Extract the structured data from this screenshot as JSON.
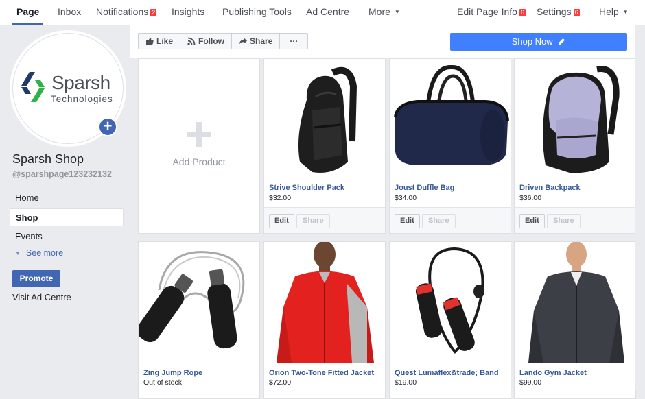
{
  "topnav": {
    "items": [
      {
        "label": "Page",
        "active": true
      },
      {
        "label": "Inbox"
      },
      {
        "label": "Notifications",
        "badge": "2"
      },
      {
        "label": "Insights"
      },
      {
        "label": "Publishing Tools"
      },
      {
        "label": "Ad Centre"
      },
      {
        "label": "More"
      }
    ],
    "right": [
      {
        "label": "Edit Page Info",
        "badge": "6"
      },
      {
        "label": "Settings",
        "badge": "6"
      },
      {
        "label": "Help"
      }
    ]
  },
  "profile": {
    "logo_text": "Sparsh",
    "logo_subtext": "Technologies",
    "page_name": "Sparsh Shop",
    "handle": "@sparshpage123232132"
  },
  "sidebar": {
    "items": [
      {
        "label": "Home"
      },
      {
        "label": "Shop",
        "active": true
      },
      {
        "label": "Events"
      }
    ],
    "see_more": "See more",
    "promote": "Promote",
    "visit_ad_centre": "Visit Ad Centre"
  },
  "actions": {
    "like": "Like",
    "follow": "Follow",
    "share": "Share",
    "more": "···",
    "shop_now": "Shop Now"
  },
  "shop": {
    "add_product": "Add Product",
    "edit_label": "Edit",
    "share_label": "Share",
    "products": [
      {
        "name": "Strive Shoulder Pack",
        "price": "$32.00",
        "image": "sling-backpack"
      },
      {
        "name": "Joust Duffle Bag",
        "price": "$34.00",
        "image": "duffle-bag"
      },
      {
        "name": "Driven Backpack",
        "price": "$36.00",
        "image": "backpack"
      },
      {
        "name": "Zing Jump Rope",
        "price": "Out of stock",
        "image": "jump-rope"
      },
      {
        "name": "Orion Two-Tone Fitted Jacket",
        "price": "$72.00",
        "image": "red-jacket"
      },
      {
        "name": "Quest Lumaflex&trade; Band",
        "price": "$19.00",
        "image": "resistance-band"
      },
      {
        "name": "Lando Gym Jacket",
        "price": "$99.00",
        "image": "grey-jacket"
      }
    ]
  },
  "colors": {
    "brand_blue": "#4267b2",
    "shop_now_blue": "#4080ff",
    "link_blue": "#365899",
    "badge_red": "#fa3e3e",
    "background": "#e9ebee"
  }
}
